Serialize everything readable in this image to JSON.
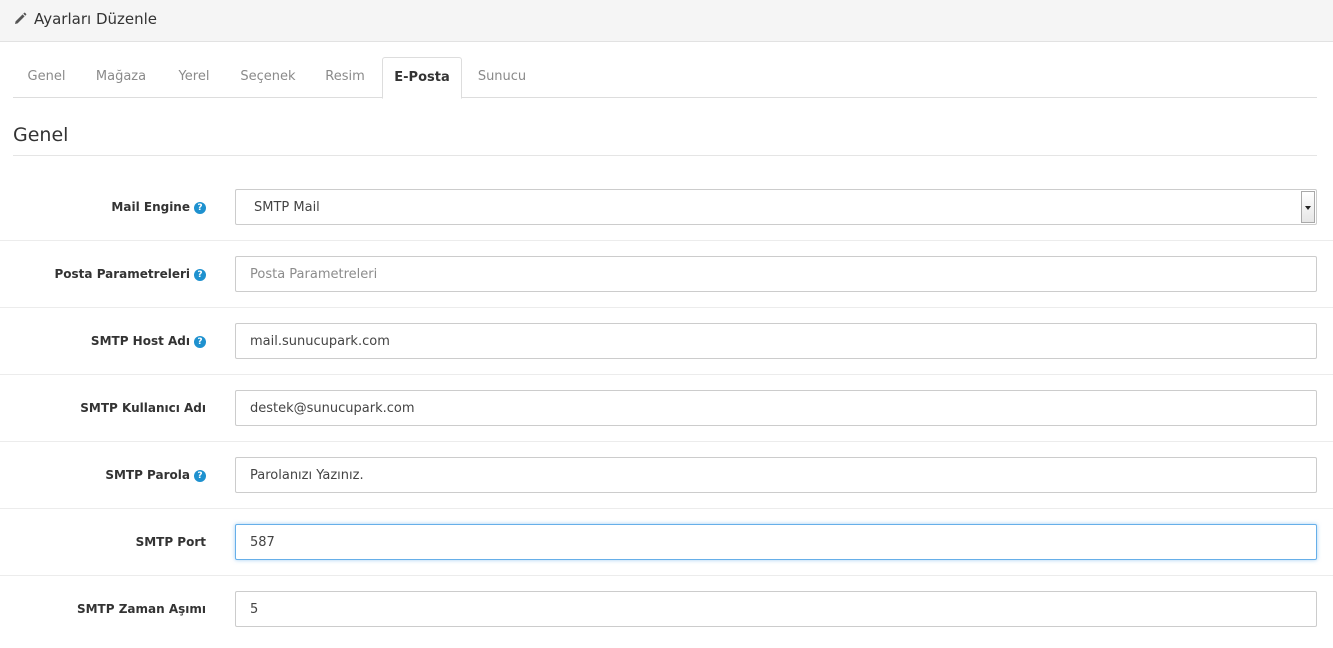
{
  "header": {
    "title": "Ayarları Düzenle",
    "icon": "pencil-icon"
  },
  "tabs": [
    {
      "label": "Genel",
      "active": false
    },
    {
      "label": "Mağaza",
      "active": false
    },
    {
      "label": "Yerel",
      "active": false
    },
    {
      "label": "Seçenek",
      "active": false
    },
    {
      "label": "Resim",
      "active": false
    },
    {
      "label": "E-Posta",
      "active": true
    },
    {
      "label": "Sunucu",
      "active": false
    }
  ],
  "section": {
    "legend": "Genel"
  },
  "help_icon_glyph": "?",
  "form": {
    "mail_engine": {
      "label": "Mail Engine",
      "value": "SMTP Mail",
      "has_help": true
    },
    "mail_parameters": {
      "label": "Posta Parametreleri",
      "value": "",
      "placeholder": "Posta Parametreleri",
      "has_help": true
    },
    "smtp_host": {
      "label": "SMTP Host Adı",
      "value": "mail.sunucupark.com",
      "has_help": true
    },
    "smtp_username": {
      "label": "SMTP Kullanıcı Adı",
      "value": "destek@sunucupark.com",
      "has_help": false
    },
    "smtp_password": {
      "label": "SMTP Parola",
      "value": "Parolanızı Yazınız.",
      "has_help": true
    },
    "smtp_port": {
      "label": "SMTP Port",
      "value": "587",
      "has_help": false
    },
    "smtp_timeout": {
      "label": "SMTP Zaman Aşımı",
      "value": "5",
      "has_help": false
    }
  },
  "colors": {
    "accent": "#1e91cf",
    "focus_border": "#66afe9"
  }
}
